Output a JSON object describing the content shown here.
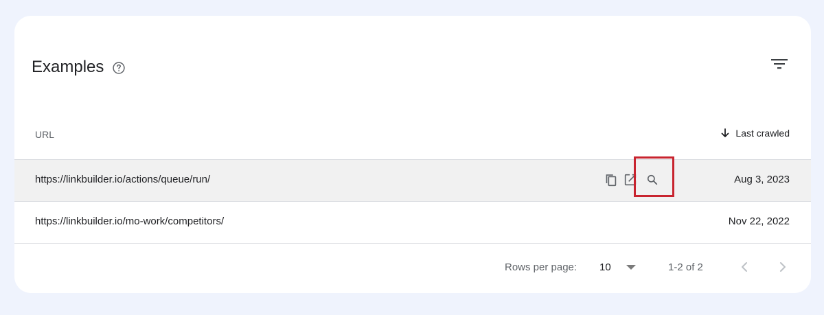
{
  "card": {
    "title": "Examples",
    "help_icon": "help-circle-icon",
    "filter_icon": "filter-icon"
  },
  "table": {
    "columns": {
      "url": "URL",
      "last_crawled": "Last crawled",
      "sort_icon": "arrow-down-icon"
    },
    "rows": [
      {
        "url": "https://linkbuilder.io/actions/queue/run/",
        "last_crawled": "Aug 3, 2023"
      },
      {
        "url": "https://linkbuilder.io/mo-work/competitors/",
        "last_crawled": "Nov 22, 2022"
      }
    ],
    "row_actions": [
      "copy-icon",
      "open-in-new-icon",
      "search-icon"
    ]
  },
  "pagination": {
    "rows_per_page_label": "Rows per page:",
    "rows_per_page_value": "10",
    "range_text": "1-2 of 2"
  },
  "colors": {
    "page_background": "#eff3fd",
    "card_background": "#ffffff",
    "hovered_row": "#f1f1f1",
    "highlight_border": "#c8242f",
    "divider": "#dadce0"
  }
}
